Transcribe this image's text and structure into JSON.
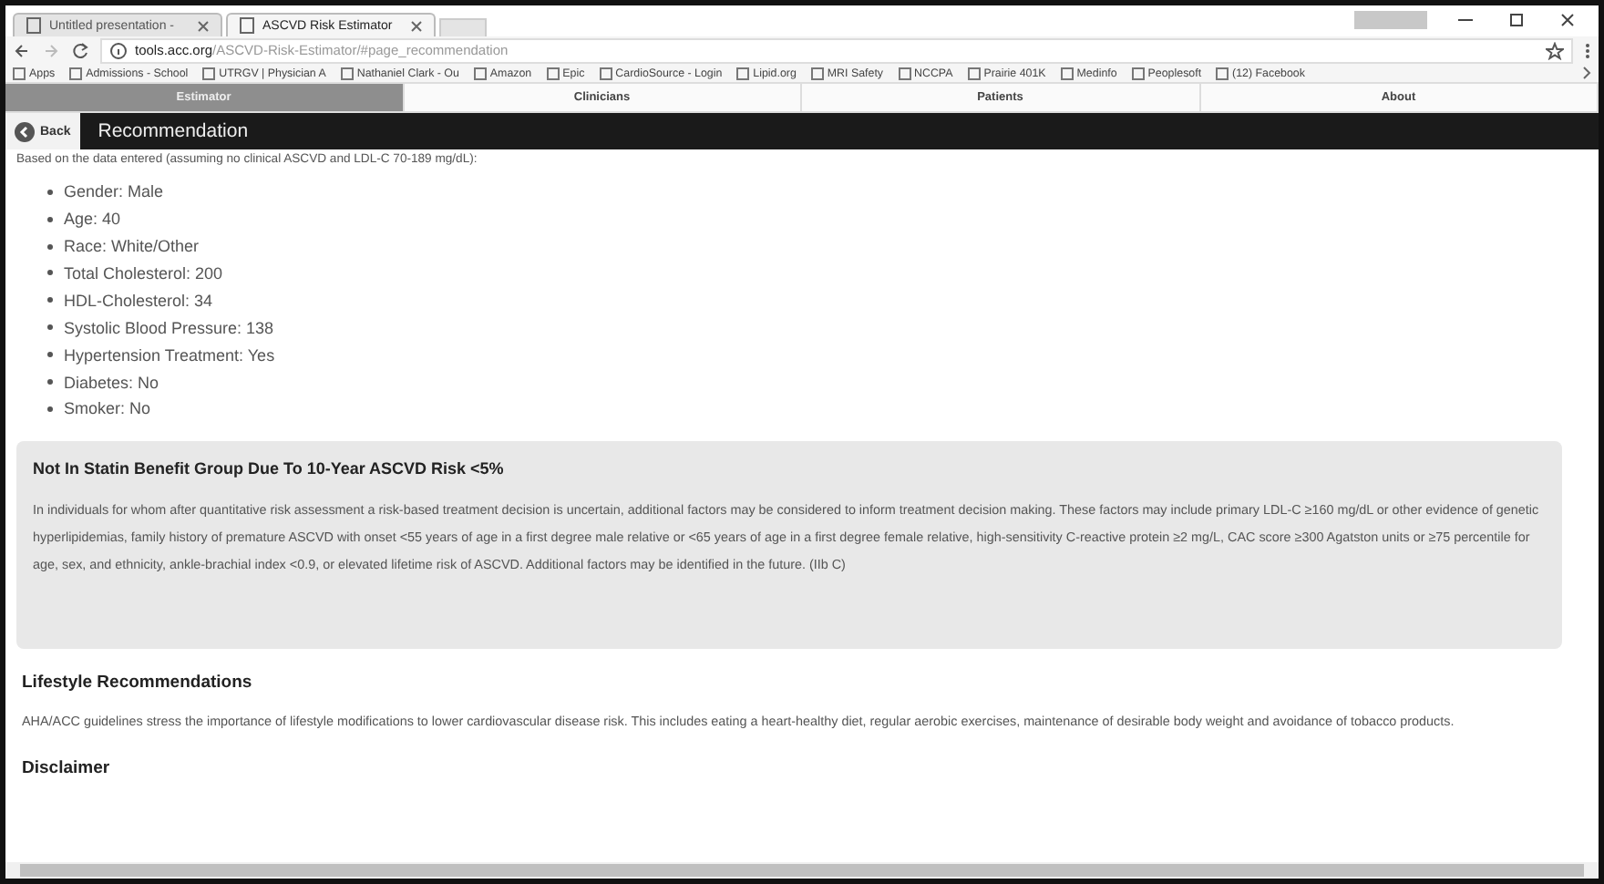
{
  "browser": {
    "tabs": [
      {
        "label": "Untitled presentation - ",
        "selected": false
      },
      {
        "label": "ASCVD Risk Estimator",
        "selected": true
      }
    ],
    "url_host": "tools.acc.org",
    "url_path": "/ASCVD-Risk-Estimator/#page_recommendation",
    "bookmarks": [
      "Apps",
      "Admissions - School",
      "UTRGV | Physician A",
      "Nathaniel Clark - Ou",
      "Amazon",
      "Epic",
      "CardioSource - Login",
      "Lipid.org",
      "MRI Safety",
      "NCCPA",
      "Prairie 401K",
      "Medinfo",
      "Peoplesoft",
      "(12) Facebook"
    ]
  },
  "nav_tabs": [
    {
      "label": "Estimator",
      "selected": true
    },
    {
      "label": "Clinicians",
      "selected": false
    },
    {
      "label": "Patients",
      "selected": false
    },
    {
      "label": "About",
      "selected": false
    }
  ],
  "header": {
    "back": "Back",
    "title": "Recommendation"
  },
  "intro": "Based on the data entered (assuming no clinical ASCVD and LDL-C 70-189 mg/dL):",
  "inputs": [
    "Gender: Male",
    "Age: 40",
    "Race: White/Other",
    "Total Cholesterol: 200",
    "HDL-Cholesterol: 34",
    "Systolic Blood Pressure: 138",
    "Hypertension Treatment: Yes",
    "Diabetes: No",
    "Smoker: No"
  ],
  "result": {
    "title": "Not In Statin Benefit Group Due To 10-Year ASCVD Risk <5%",
    "text": "In individuals for whom after quantitative risk assessment a risk-based treatment decision is uncertain, additional factors may be considered to inform treatment decision making. These factors may include primary LDL-C ≥160 mg/dL or other evidence of genetic hyperlipidemias, family history of premature ASCVD with onset <55 years of age in a first degree male relative or <65 years of age in a first degree female relative, high-sensitivity C-reactive protein ≥2 mg/L, CAC score ≥300 Agatston units or ≥75 percentile for age, sex, and ethnicity, ankle-brachial index <0.9, or elevated lifetime risk of ASCVD. Additional factors may be identified in the future. (IIb C)"
  },
  "sections": [
    {
      "title": "Lifestyle Recommendations",
      "text": "AHA/ACC guidelines stress the importance of lifestyle modifications to lower cardiovascular disease risk. This includes eating a heart-healthy diet, regular aerobic exercises, maintenance of desirable body weight and avoidance of tobacco products."
    },
    {
      "title": "Disclaimer"
    }
  ]
}
